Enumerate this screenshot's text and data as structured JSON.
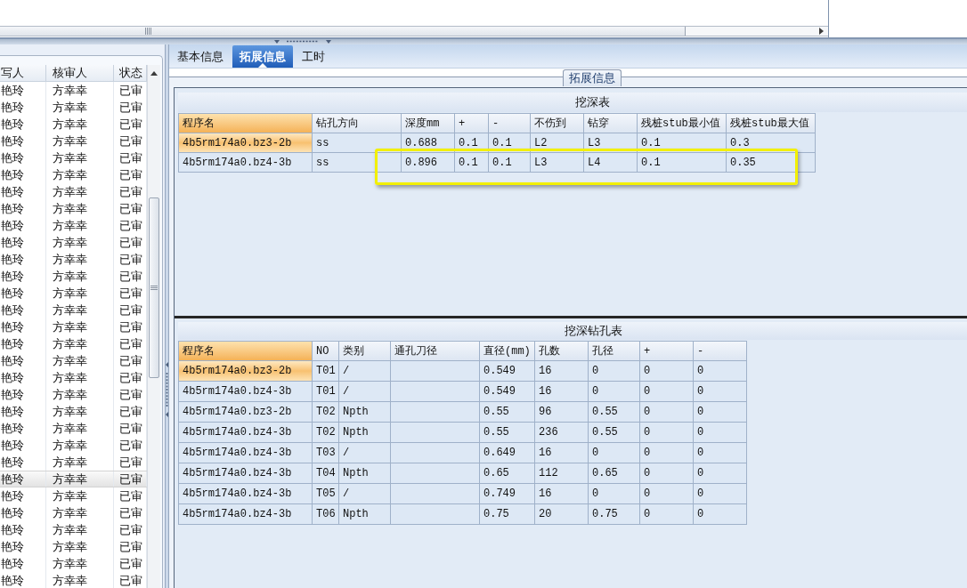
{
  "left_list": {
    "columns": [
      "写人",
      "核审人",
      "状态"
    ],
    "rows": [
      {
        "cells": [
          "艳玲",
          "方幸幸",
          "已审"
        ],
        "selected": false
      },
      {
        "cells": [
          "艳玲",
          "方幸幸",
          "已审"
        ],
        "selected": false
      },
      {
        "cells": [
          "艳玲",
          "方幸幸",
          "已审"
        ],
        "selected": false
      },
      {
        "cells": [
          "艳玲",
          "方幸幸",
          "已审"
        ],
        "selected": false
      },
      {
        "cells": [
          "艳玲",
          "方幸幸",
          "已审"
        ],
        "selected": false
      },
      {
        "cells": [
          "艳玲",
          "方幸幸",
          "已审"
        ],
        "selected": false
      },
      {
        "cells": [
          "艳玲",
          "方幸幸",
          "已审"
        ],
        "selected": false
      },
      {
        "cells": [
          "艳玲",
          "方幸幸",
          "已审"
        ],
        "selected": false
      },
      {
        "cells": [
          "艳玲",
          "方幸幸",
          "已审"
        ],
        "selected": false
      },
      {
        "cells": [
          "艳玲",
          "方幸幸",
          "已审"
        ],
        "selected": false
      },
      {
        "cells": [
          "艳玲",
          "方幸幸",
          "已审"
        ],
        "selected": false
      },
      {
        "cells": [
          "艳玲",
          "方幸幸",
          "已审"
        ],
        "selected": false
      },
      {
        "cells": [
          "艳玲",
          "方幸幸",
          "已审"
        ],
        "selected": false
      },
      {
        "cells": [
          "艳玲",
          "方幸幸",
          "已审"
        ],
        "selected": false
      },
      {
        "cells": [
          "艳玲",
          "方幸幸",
          "已审"
        ],
        "selected": false
      },
      {
        "cells": [
          "艳玲",
          "方幸幸",
          "已审"
        ],
        "selected": false
      },
      {
        "cells": [
          "艳玲",
          "方幸幸",
          "已审"
        ],
        "selected": false
      },
      {
        "cells": [
          "艳玲",
          "方幸幸",
          "已审"
        ],
        "selected": false
      },
      {
        "cells": [
          "艳玲",
          "方幸幸",
          "已审"
        ],
        "selected": false
      },
      {
        "cells": [
          "艳玲",
          "方幸幸",
          "已审"
        ],
        "selected": false
      },
      {
        "cells": [
          "艳玲",
          "方幸幸",
          "已审"
        ],
        "selected": false
      },
      {
        "cells": [
          "艳玲",
          "方幸幸",
          "已审"
        ],
        "selected": false
      },
      {
        "cells": [
          "艳玲",
          "方幸幸",
          "已审"
        ],
        "selected": false
      },
      {
        "cells": [
          "艳玲",
          "方幸幸",
          "已审"
        ],
        "selected": true
      },
      {
        "cells": [
          "艳玲",
          "方幸幸",
          "已审"
        ],
        "selected": false
      },
      {
        "cells": [
          "艳玲",
          "方幸幸",
          "已审"
        ],
        "selected": false
      },
      {
        "cells": [
          "艳玲",
          "方幸幸",
          "已审"
        ],
        "selected": false
      },
      {
        "cells": [
          "艳玲",
          "方幸幸",
          "已审"
        ],
        "selected": false
      },
      {
        "cells": [
          "艳玲",
          "方幸幸",
          "已审"
        ],
        "selected": false
      },
      {
        "cells": [
          "艳玲",
          "方幸幸",
          "已审"
        ],
        "selected": false
      }
    ]
  },
  "tabs": [
    {
      "label": "基本信息",
      "selected": false
    },
    {
      "label": "拓展信息",
      "selected": true
    },
    {
      "label": "工时",
      "selected": false
    }
  ],
  "group_title": "拓展信息",
  "depth_table": {
    "title": "挖深表",
    "columns": [
      {
        "label": "程序名",
        "selected": true
      },
      {
        "label": "钻孔方向",
        "selected": false
      },
      {
        "label": "深度mm",
        "selected": false
      },
      {
        "label": "+",
        "selected": false
      },
      {
        "label": "-",
        "selected": false
      },
      {
        "label": "不伤到",
        "selected": false
      },
      {
        "label": "钻穿",
        "selected": false
      },
      {
        "label": "残桩stub最小值",
        "selected": false
      },
      {
        "label": "残桩stub最大值",
        "selected": false
      }
    ],
    "rows": [
      {
        "cells": [
          "4b5rm174a0.bz3-2b",
          "ss",
          "0.688",
          "0.1",
          "0.1",
          "L2",
          "L3",
          "0.1",
          "0.3"
        ],
        "selected": true,
        "highlighted": false
      },
      {
        "cells": [
          "4b5rm174a0.bz4-3b",
          "ss",
          "0.896",
          "0.1",
          "0.1",
          "L3",
          "L4",
          "0.1",
          "0.35"
        ],
        "selected": false,
        "highlighted": true
      }
    ]
  },
  "drill_table": {
    "title": "挖深钻孔表",
    "columns": [
      {
        "label": "程序名",
        "selected": true
      },
      {
        "label": "NO",
        "selected": false
      },
      {
        "label": "类别",
        "selected": false
      },
      {
        "label": "通孔刀径",
        "selected": false
      },
      {
        "label": "直径(mm)",
        "selected": false
      },
      {
        "label": "孔数",
        "selected": false
      },
      {
        "label": "孔径",
        "selected": false
      },
      {
        "label": "+",
        "selected": false
      },
      {
        "label": "-",
        "selected": false
      }
    ],
    "rows": [
      {
        "cells": [
          "4b5rm174a0.bz3-2b",
          "T01",
          "/",
          null,
          "0.549",
          "16",
          "0",
          "0",
          "0"
        ],
        "selected": true
      },
      {
        "cells": [
          "4b5rm174a0.bz4-3b",
          "T01",
          "/",
          null,
          "0.549",
          "16",
          "0",
          "0",
          "0"
        ],
        "selected": false
      },
      {
        "cells": [
          "4b5rm174a0.bz3-2b",
          "T02",
          "Npth",
          null,
          "0.55",
          "96",
          "0.55",
          "0",
          "0"
        ],
        "selected": false
      },
      {
        "cells": [
          "4b5rm174a0.bz4-3b",
          "T02",
          "Npth",
          null,
          "0.55",
          "236",
          "0.55",
          "0",
          "0"
        ],
        "selected": false
      },
      {
        "cells": [
          "4b5rm174a0.bz4-3b",
          "T03",
          "/",
          null,
          "0.649",
          "16",
          "0",
          "0",
          "0"
        ],
        "selected": false
      },
      {
        "cells": [
          "4b5rm174a0.bz4-3b",
          "T04",
          "Npth",
          null,
          "0.65",
          "112",
          "0.65",
          "0",
          "0"
        ],
        "selected": false
      },
      {
        "cells": [
          "4b5rm174a0.bz4-3b",
          "T05",
          "/",
          null,
          "0.749",
          "16",
          "0",
          "0",
          "0"
        ],
        "selected": false
      },
      {
        "cells": [
          "4b5rm174a0.bz4-3b",
          "T06",
          "Npth",
          null,
          "0.75",
          "20",
          "0.75",
          "0",
          "0"
        ],
        "selected": false
      }
    ]
  }
}
